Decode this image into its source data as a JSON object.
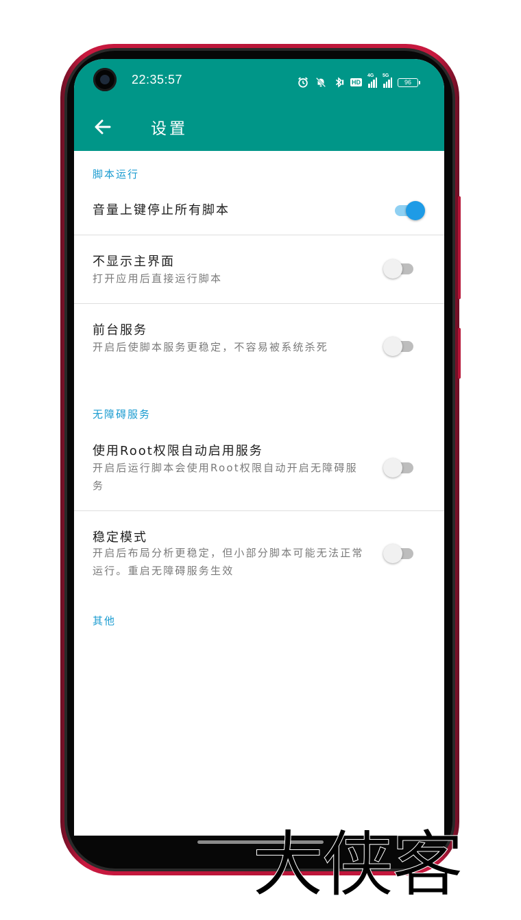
{
  "status_bar": {
    "time": "22:35:57",
    "hd_label": "HD",
    "net1_label": "4G",
    "net2_label": "5G",
    "battery_level": "96",
    "icons": [
      "alarm-icon",
      "mute-icon",
      "bluetooth-icon",
      "hd-icon",
      "signal-4g-icon",
      "signal-5g-icon",
      "battery-icon"
    ]
  },
  "app_bar": {
    "title": "设置",
    "back_icon": "arrow-left-icon"
  },
  "sections": [
    {
      "header": "脚本运行",
      "items": [
        {
          "title": "音量上键停止所有脚本",
          "summary": "",
          "enabled": true
        },
        {
          "title": "不显示主界面",
          "summary": "打开应用后直接运行脚本",
          "enabled": false
        },
        {
          "title": "前台服务",
          "summary": "开启后使脚本服务更稳定，不容易被系统杀死",
          "enabled": false
        }
      ]
    },
    {
      "header": "无障碍服务",
      "items": [
        {
          "title": "使用Root权限自动启用服务",
          "summary": "开启后运行脚本会使用Root权限自动开启无障碍服务",
          "enabled": false
        },
        {
          "title": "稳定模式",
          "summary": "开启后布局分析更稳定，但小部分脚本可能无法正常运行。重启无障碍服务生效",
          "enabled": false
        }
      ]
    },
    {
      "header": "其他",
      "items": []
    }
  ],
  "colors": {
    "primary": "#009688",
    "accent": "#1e9be6",
    "section_header": "#1a9bd0",
    "frame": "#c8193f"
  },
  "watermark": "大侠客"
}
